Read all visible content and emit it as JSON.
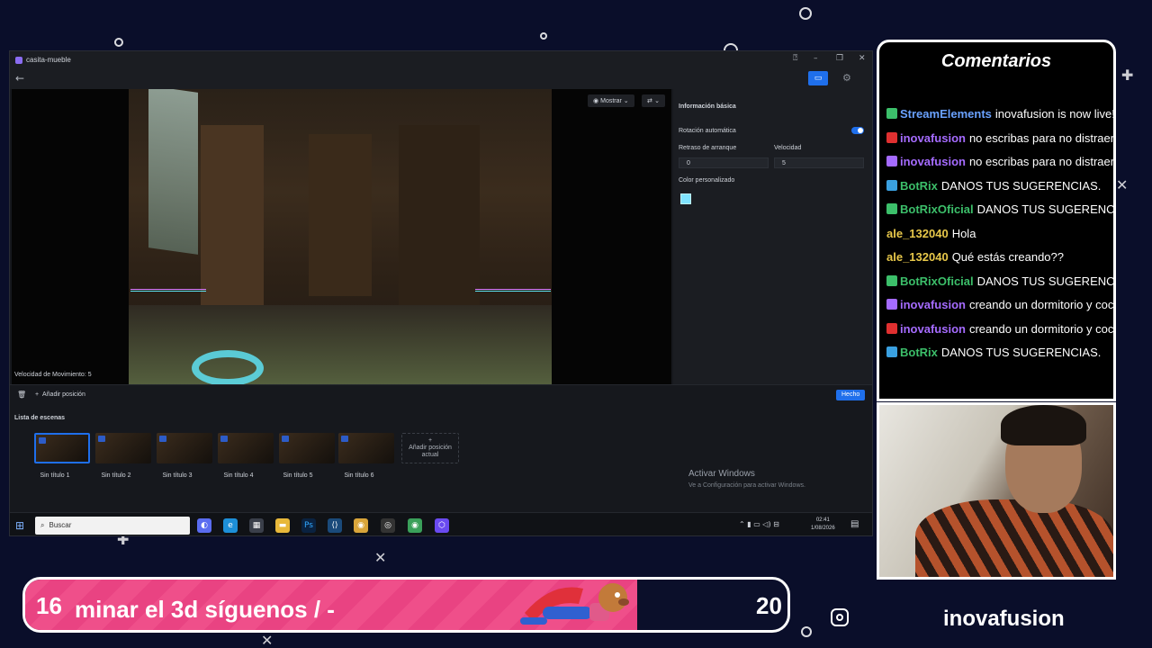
{
  "app": {
    "window_title": "casita-mueble",
    "viewport": {
      "show_label": "Mostrar",
      "speed_label": "Velocidad de Movimiento: 5"
    },
    "side_panel": {
      "section_title": "Información básica",
      "auto_rotation_label": "Rotación automática",
      "auto_rotation_on": true,
      "start_delay_label": "Retraso de arranque",
      "start_delay_value": "0",
      "speed_label": "Velocidad",
      "speed_value": "5",
      "custom_color_label": "Color personalizado",
      "custom_color": "#7fe3ff"
    },
    "bottom_bar": {
      "add_position_label": "Añadir posición",
      "done_label": "Hecho"
    },
    "scenes": {
      "title": "Lista de escenas",
      "items": [
        {
          "label": "Sin título 1",
          "active": true
        },
        {
          "label": "Sin título 2",
          "active": false
        },
        {
          "label": "Sin título 3",
          "active": false
        },
        {
          "label": "Sin título 4",
          "active": false
        },
        {
          "label": "Sin título 5",
          "active": false
        },
        {
          "label": "Sin título 6",
          "active": false
        }
      ],
      "add_current_label_1": "Añadir posición",
      "add_current_label_2": "actual"
    },
    "activate_windows": {
      "title": "Activar Windows",
      "subtitle": "Ve a Configuración para activar Windows."
    },
    "taskbar": {
      "search_placeholder": "Buscar",
      "time": "02:41",
      "date": "1/08/2026"
    }
  },
  "chat": {
    "title": "Comentarios",
    "messages": [
      {
        "user": "StreamElements",
        "user_color": "#6aa2ff",
        "badge_color": "#3cbf6a",
        "text": "inovafusion is now live! UNA ANIMACION"
      },
      {
        "user": "inovafusion",
        "user_color": "#a56bff",
        "badge_color": "#e03030",
        "text": "no escribas para no distraer"
      },
      {
        "user": "inovafusion",
        "user_color": "#a56bff",
        "badge_color": "#a56bff",
        "text": "no escribas para no distraer"
      },
      {
        "user": "BotRix",
        "user_color": "#3cbf6a",
        "badge_color": "#3aa0e0",
        "text": "DANOS TUS SUGERENCIAS."
      },
      {
        "user": "BotRixOficial",
        "user_color": "#3cbf6a",
        "badge_color": "#3cbf6a",
        "text": "DANOS TUS SUGERENCIAS."
      },
      {
        "user": "ale_132040",
        "user_color": "#e8c84a",
        "badge_color": "",
        "text": "Hola"
      },
      {
        "user": "ale_132040",
        "user_color": "#e8c84a",
        "badge_color": "",
        "text": "Qué estás creando??"
      },
      {
        "user": "BotRixOficial",
        "user_color": "#3cbf6a",
        "badge_color": "#3cbf6a",
        "text": "DANOS TUS SUGERENCIAS."
      },
      {
        "user": "inovafusion",
        "user_color": "#a56bff",
        "badge_color": "#a56bff",
        "text": "creando un dormitorio y cocina"
      },
      {
        "user": "inovafusion",
        "user_color": "#a56bff",
        "badge_color": "#e03030",
        "text": "creando un dormitorio y cocina"
      },
      {
        "user": "BotRix",
        "user_color": "#3cbf6a",
        "badge_color": "#3aa0e0",
        "text": "DANOS TUS SUGERENCIAS."
      }
    ]
  },
  "ticker": {
    "left_number": "16",
    "text": "minar el 3d      síguenos   /  -",
    "right_number": "20"
  },
  "social": {
    "icon": "instagram-icon",
    "handle": "inovafusion"
  }
}
